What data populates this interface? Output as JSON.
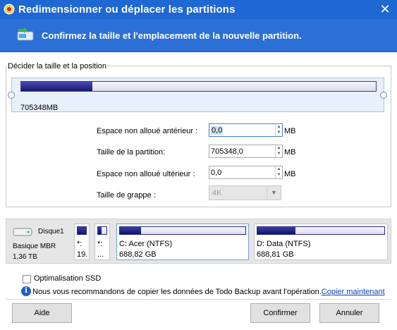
{
  "window": {
    "title": "Redimensionner ou déplacer les partitions",
    "close_glyph": "✕",
    "accent_color": "#1f67d2"
  },
  "header": {
    "text": "Confirmez la taille et l'emplacement de la nouvelle partition.",
    "icon": "partition-arrows-icon"
  },
  "size_group": {
    "label": "Décider la taille et la position",
    "partition_size_text": "705348MB",
    "slider_used_fraction": 0.2
  },
  "fields": {
    "unallocated_before": {
      "label": "Espace non alloué antérieur :",
      "value": "0,0",
      "unit": "MB"
    },
    "partition_size": {
      "label": "Taille de la partition:",
      "value": "705348,0",
      "unit": "MB"
    },
    "unallocated_after": {
      "label": "Espace non alloué ultérieur :",
      "value": "0,0",
      "unit": "MB"
    },
    "cluster_size": {
      "label": "Taille de grappe :",
      "value": "4K"
    }
  },
  "disk_map": {
    "disk_name": "Disque1",
    "disk_type": "Basique MBR",
    "disk_size": "1,36 TB",
    "partitions": [
      {
        "line1": "*:",
        "line2": "19."
      },
      {
        "line1": "*:",
        "line2": "..."
      },
      {
        "line1": "C: Acer (NTFS)",
        "line2": "688,82 GB",
        "used_fraction": 0.17
      },
      {
        "line1": "D: Data (NTFS)",
        "line2": "688,81 GB",
        "used_fraction": 0.3
      }
    ]
  },
  "options": {
    "ssd_label": "Optimalisation SSD",
    "ssd_checked": false
  },
  "info": {
    "text": "Nous vous recommandons de copier les données de Todo Backup  avant l'opération.",
    "link": "Copier maintenant"
  },
  "buttons": {
    "help": "Aide",
    "confirm": "Confirmer",
    "cancel": "Annuler"
  }
}
